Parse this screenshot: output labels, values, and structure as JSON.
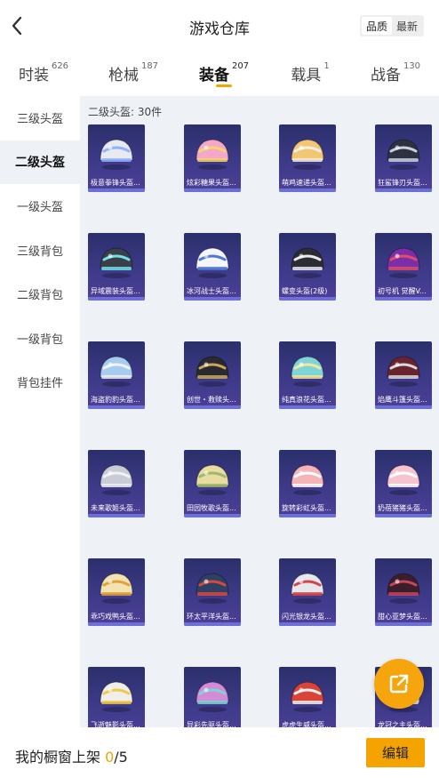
{
  "header": {
    "title": "游戏仓库",
    "sort_options": [
      "品质",
      "最新"
    ],
    "active_sort": 0
  },
  "tabs": [
    {
      "label": "时装",
      "count": "626"
    },
    {
      "label": "枪械",
      "count": "187"
    },
    {
      "label": "装备",
      "count": "207",
      "active": true
    },
    {
      "label": "载具",
      "count": "1"
    },
    {
      "label": "战备",
      "count": "130"
    }
  ],
  "sidebar": [
    {
      "label": "三级头盔"
    },
    {
      "label": "二级头盔",
      "active": true
    },
    {
      "label": "一级头盔"
    },
    {
      "label": "三级背包"
    },
    {
      "label": "二级背包"
    },
    {
      "label": "一级背包"
    },
    {
      "label": "背包挂件"
    }
  ],
  "section_title": "二级头盔: 30件",
  "items": [
    {
      "name": "极意拳锋头盔...",
      "color": "#e9e9f0",
      "accent": "#8fb3ff"
    },
    {
      "name": "炫彩糖果头盔...",
      "color": "#f3a7c9",
      "accent": "#f7d66a"
    },
    {
      "name": "萌鸡速递头盔...",
      "color": "#f2c774",
      "accent": "#f4f0e0"
    },
    {
      "name": "狂鲨锋刃头盔...",
      "color": "#2e3140",
      "accent": "#c9d0e0"
    },
    {
      "name": "异域震装头盔...",
      "color": "#3a3f4a",
      "accent": "#6ee2e6"
    },
    {
      "name": "冰河战士头盔...",
      "color": "#f4f6fb",
      "accent": "#4f79d6"
    },
    {
      "name": "螺变头盔(2级)",
      "color": "#2b2d33",
      "accent": "#e7e9ee"
    },
    {
      "name": "初号机 觉醒V...",
      "color": "#7b2ea8",
      "accent": "#e34b6b"
    },
    {
      "name": "海盗豹豹头盔...",
      "color": "#a6cdee",
      "accent": "#f2f2f2"
    },
    {
      "name": "创世・救赎头...",
      "color": "#2a2a2e",
      "accent": "#c9a85c"
    },
    {
      "name": "纯真浪花头盔...",
      "color": "#7fd4d8",
      "accent": "#f4e79b"
    },
    {
      "name": "焰鹰斗篷头盔...",
      "color": "#6a2430",
      "accent": "#d9d9d9"
    },
    {
      "name": "未来歌姬头盔...",
      "color": "#c9ccd6",
      "accent": "#f1f2f6"
    },
    {
      "name": "田园牧歌头盔...",
      "color": "#e8dca0",
      "accent": "#9fb86a"
    },
    {
      "name": "旋转彩虹头盔...",
      "color": "#f6b3b8",
      "accent": "#ffffff"
    },
    {
      "name": "奶蓓猪猪头盔...",
      "color": "#f6c4cf",
      "accent": "#ffffff"
    },
    {
      "name": "乖巧戏鸭头盔...",
      "color": "#f3e3b0",
      "accent": "#e2a13c"
    },
    {
      "name": "环太平洋头盔...",
      "color": "#2f4066",
      "accent": "#d94a3a"
    },
    {
      "name": "闪光银龙头盔...",
      "color": "#e6e8ee",
      "accent": "#d3454a"
    },
    {
      "name": "甜心亚梦头盔...",
      "color": "#3a1e2a",
      "accent": "#c8435e"
    },
    {
      "name": "飞逝魅影头盔...",
      "color": "#f0eee8",
      "accent": "#f0c94b"
    },
    {
      "name": "异彩先驱头盔...",
      "color": "#d38bd6",
      "accent": "#7ad6d6"
    },
    {
      "name": "虎虎生威头盔...",
      "color": "#d9443a",
      "accent": "#f4f1ea"
    },
    {
      "name": "龙冠之主头盔...",
      "color": "#c8cbd5",
      "accent": "#f2f2f2"
    }
  ],
  "bottom": {
    "shelf_label": "我的橱窗上架 ",
    "shelf_current": "0",
    "shelf_total": "/5",
    "edit_label": "编辑"
  },
  "colors": {
    "accent": "#f5a300",
    "content_bg": "#eef2f7",
    "card_bg": "#3d3a88"
  }
}
